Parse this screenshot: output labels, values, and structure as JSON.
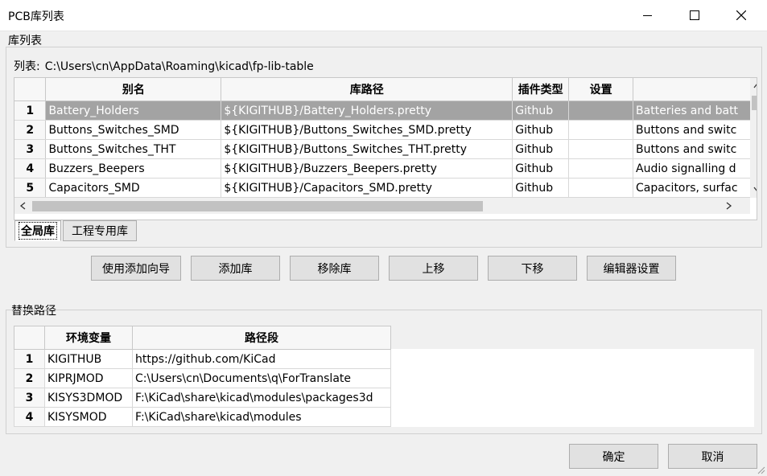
{
  "window": {
    "title": "PCB库列表"
  },
  "libs_group": {
    "label": "库列表",
    "path_label": "列表:",
    "path_value": "C:\\Users\\cn\\AppData\\Roaming\\kicad\\fp-lib-table"
  },
  "lib_table": {
    "columns": [
      "别名",
      "库路径",
      "插件类型",
      "设置",
      ""
    ],
    "rows": [
      {
        "num": "1",
        "alias": "Battery_Holders",
        "path": "${KIGITHUB}/Battery_Holders.pretty",
        "plugin": "Github",
        "options": "",
        "desc": "Batteries and batt"
      },
      {
        "num": "2",
        "alias": "Buttons_Switches_SMD",
        "path": "${KIGITHUB}/Buttons_Switches_SMD.pretty",
        "plugin": "Github",
        "options": "",
        "desc": "Buttons and switc"
      },
      {
        "num": "3",
        "alias": "Buttons_Switches_THT",
        "path": "${KIGITHUB}/Buttons_Switches_THT.pretty",
        "plugin": "Github",
        "options": "",
        "desc": "Buttons and switc"
      },
      {
        "num": "4",
        "alias": "Buzzers_Beepers",
        "path": "${KIGITHUB}/Buzzers_Beepers.pretty",
        "plugin": "Github",
        "options": "",
        "desc": "Audio signalling d"
      },
      {
        "num": "5",
        "alias": "Capacitors_SMD",
        "path": "${KIGITHUB}/Capacitors_SMD.pretty",
        "plugin": "Github",
        "options": "",
        "desc": "Capacitors, surfac"
      }
    ]
  },
  "tabs": [
    "全局库",
    "工程专用库"
  ],
  "buttons": {
    "wizard": "使用添加向导",
    "add": "添加库",
    "remove": "移除库",
    "up": "上移",
    "down": "下移",
    "editor": "编辑器设置"
  },
  "subst_group": {
    "label": "替换路径",
    "columns": [
      "环境变量",
      "路径段"
    ],
    "rows": [
      {
        "num": "1",
        "var": "KIGITHUB",
        "value": "https://github.com/KiCad"
      },
      {
        "num": "2",
        "var": "KIPRJMOD",
        "value": "C:\\Users\\cn\\Documents\\q\\ForTranslate"
      },
      {
        "num": "3",
        "var": "KISYS3DMOD",
        "value": "F:\\KiCad\\share\\kicad\\modules\\packages3d"
      },
      {
        "num": "4",
        "var": "KISYSMOD",
        "value": "F:\\KiCad\\share\\kicad\\modules"
      }
    ]
  },
  "dialog": {
    "ok": "确定",
    "cancel": "取消"
  },
  "icons": [
    "minimize-icon",
    "maximize-icon",
    "close-icon",
    "chevron-up-icon",
    "chevron-down-icon",
    "chevron-left-icon",
    "chevron-right-icon",
    "resize-grip-icon"
  ],
  "colors": {
    "selected_row": "#a3a3a3",
    "window_bg": "#f0f0f0"
  }
}
